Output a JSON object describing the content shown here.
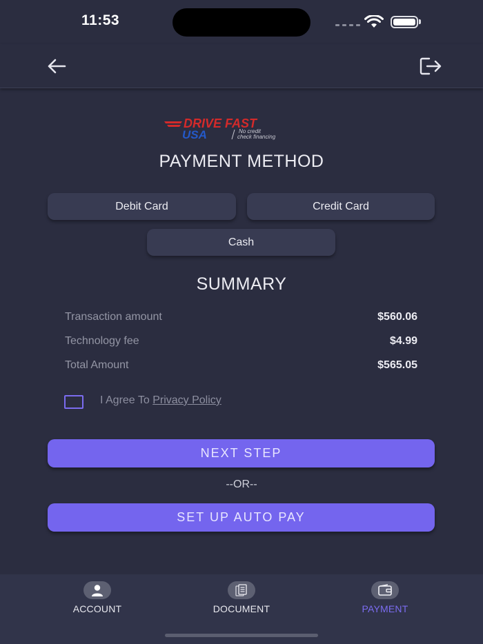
{
  "status_bar": {
    "time": "11:53"
  },
  "logo": {
    "line1": "DRIVE FAST",
    "line2": "USA",
    "tagline1": "No credit",
    "tagline2": "check financing"
  },
  "page_title": "PAYMENT METHOD",
  "payment_methods": {
    "debit": "Debit Card",
    "credit": "Credit Card",
    "cash": "Cash"
  },
  "summary": {
    "title": "SUMMARY",
    "rows": [
      {
        "label": "Transaction amount",
        "value": "$560.06"
      },
      {
        "label": "Technology fee",
        "value": "$4.99"
      },
      {
        "label": "Total Amount",
        "value": "$565.05"
      }
    ]
  },
  "agree": {
    "prefix": "I Agree To ",
    "link": "Privacy Policy",
    "checked": false
  },
  "actions": {
    "next": "NEXT STEP",
    "or": "--OR--",
    "autopay": "SET UP AUTO PAY"
  },
  "nav": {
    "account": "ACCOUNT",
    "document": "DOCUMENT",
    "payment": "PAYMENT",
    "active": "payment"
  },
  "colors": {
    "background": "#2b2d40",
    "accent": "#7465ee",
    "brand_red": "#d42a2a",
    "brand_blue": "#2459c9"
  }
}
